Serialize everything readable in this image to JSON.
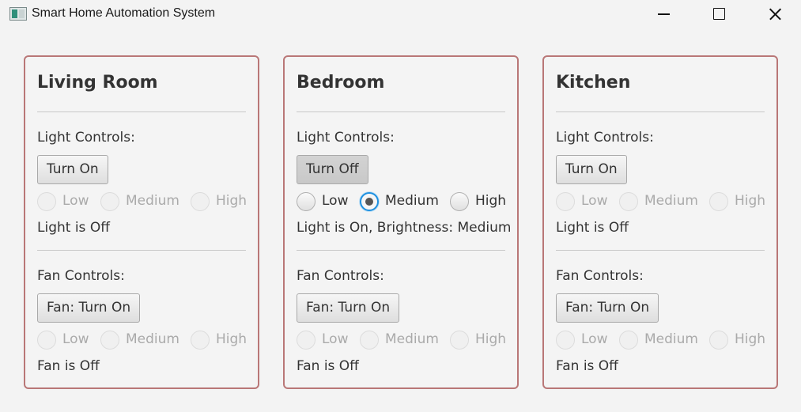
{
  "window": {
    "title": "Smart Home Automation System"
  },
  "rooms": [
    {
      "name": "Living Room",
      "light": {
        "controls_label": "Light Controls:",
        "button_label": "Turn On",
        "levels": [
          "Low",
          "Medium",
          "High"
        ],
        "status": "Light is Off"
      },
      "fan": {
        "controls_label": "Fan Controls:",
        "button_label": "Fan: Turn On",
        "levels": [
          "Low",
          "Medium",
          "High"
        ],
        "status": "Fan is Off"
      }
    },
    {
      "name": "Bedroom",
      "light": {
        "controls_label": "Light Controls:",
        "button_label": "Turn Off",
        "levels": [
          "Low",
          "Medium",
          "High"
        ],
        "selected_level": "Medium",
        "status": "Light is On, Brightness: Medium"
      },
      "fan": {
        "controls_label": "Fan Controls:",
        "button_label": "Fan: Turn On",
        "levels": [
          "Low",
          "Medium",
          "High"
        ],
        "status": "Fan is Off"
      }
    },
    {
      "name": "Kitchen",
      "light": {
        "controls_label": "Light Controls:",
        "button_label": "Turn On",
        "levels": [
          "Low",
          "Medium",
          "High"
        ],
        "status": "Light is Off"
      },
      "fan": {
        "controls_label": "Fan Controls:",
        "button_label": "Fan: Turn On",
        "levels": [
          "Low",
          "Medium",
          "High"
        ],
        "status": "Fan is Off"
      }
    }
  ],
  "colors": {
    "panel_border": "#b97777",
    "radio_focus": "#1e90e0",
    "background": "#f3f3f3"
  }
}
